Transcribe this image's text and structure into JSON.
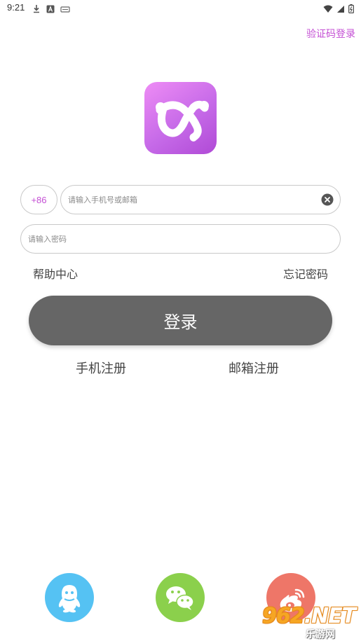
{
  "status_bar": {
    "time": "9:21",
    "left_icons": [
      "download-icon",
      "a-icon",
      "screen-icon"
    ],
    "right_icons": [
      "wifi-icon",
      "signal-icon",
      "battery-icon"
    ]
  },
  "header": {
    "code_login_label": "验证码登录"
  },
  "login_form": {
    "country_code": "+86",
    "phone_placeholder": "请输入手机号或邮箱",
    "phone_value": "",
    "password_placeholder": "请输入密码",
    "password_value": "",
    "help_label": "帮助中心",
    "forgot_label": "忘记密码",
    "login_label": "登录"
  },
  "register": {
    "phone_label": "手机注册",
    "email_label": "邮箱注册"
  },
  "social_login": [
    {
      "name": "qq",
      "icon": "qq-icon",
      "color": "#55c2f3"
    },
    {
      "name": "wechat",
      "icon": "wechat-icon",
      "color": "#8bd04c"
    },
    {
      "name": "weibo",
      "icon": "weibo-icon",
      "color": "#ee7668"
    }
  ],
  "watermark": {
    "main_digits": "962",
    "main_suffix": ".NET",
    "sub": "乐游网"
  },
  "colors": {
    "accent": "#c44fd4",
    "login_button": "#666666",
    "border": "#c9c9c9"
  }
}
